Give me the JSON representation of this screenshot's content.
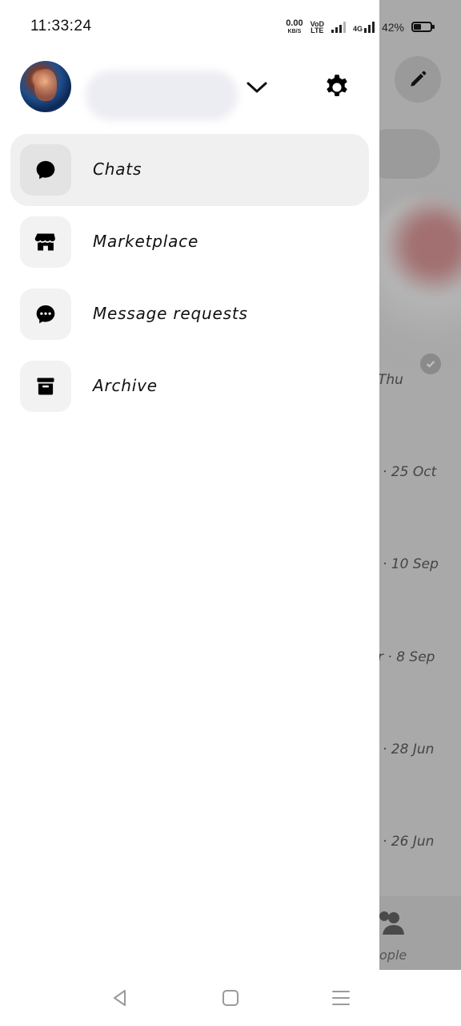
{
  "status_bar": {
    "time": "11:33:24",
    "net_speed_value": "0.00",
    "net_speed_unit": "KB/S",
    "volte_line1": "VoD",
    "volte_line2": "LTE",
    "network_type": "4G",
    "battery_percent": "42%",
    "battery_level": 0.42
  },
  "drawer": {
    "settings_icon": "gear-icon",
    "account_switch_icon": "chevron-down-icon",
    "menu": [
      {
        "label": "Chats",
        "icon": "chat-bubble-icon",
        "active": true
      },
      {
        "label": "Marketplace",
        "icon": "storefront-icon",
        "active": false
      },
      {
        "label": "Message requests",
        "icon": "message-requests-icon",
        "active": false
      },
      {
        "label": "Archive",
        "icon": "archive-box-icon",
        "active": false
      }
    ]
  },
  "background": {
    "compose_icon": "pencil-icon",
    "chat_times": [
      "Thu",
      "· 25 Oct",
      "· 10 Sep",
      "r · 8 Sep",
      "· 28 Jun",
      "· 26 Jun"
    ],
    "nav_label": "ople"
  },
  "system_nav": {
    "back_icon": "back-triangle-icon",
    "home_icon": "home-square-icon",
    "recents_icon": "menu-lines-icon"
  },
  "colors": {
    "overlay": "#a9a9a9",
    "active_item_bg": "#f0f0f0",
    "icon_bg": "#f2f2f2"
  }
}
